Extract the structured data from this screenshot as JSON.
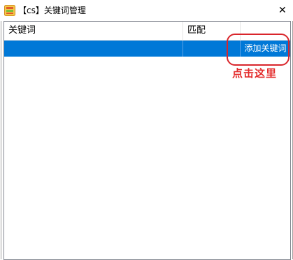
{
  "window": {
    "title": "【cs】关键词管理",
    "close_glyph": "✕"
  },
  "table": {
    "columns": [
      "关键词",
      "匹配",
      ""
    ],
    "rows": [
      {
        "keyword": "",
        "match": "",
        "action_label": "添加关键词"
      }
    ],
    "selection_color": "#0078d7"
  },
  "annotation": {
    "text": "点击这里",
    "color": "#e32b2b"
  }
}
